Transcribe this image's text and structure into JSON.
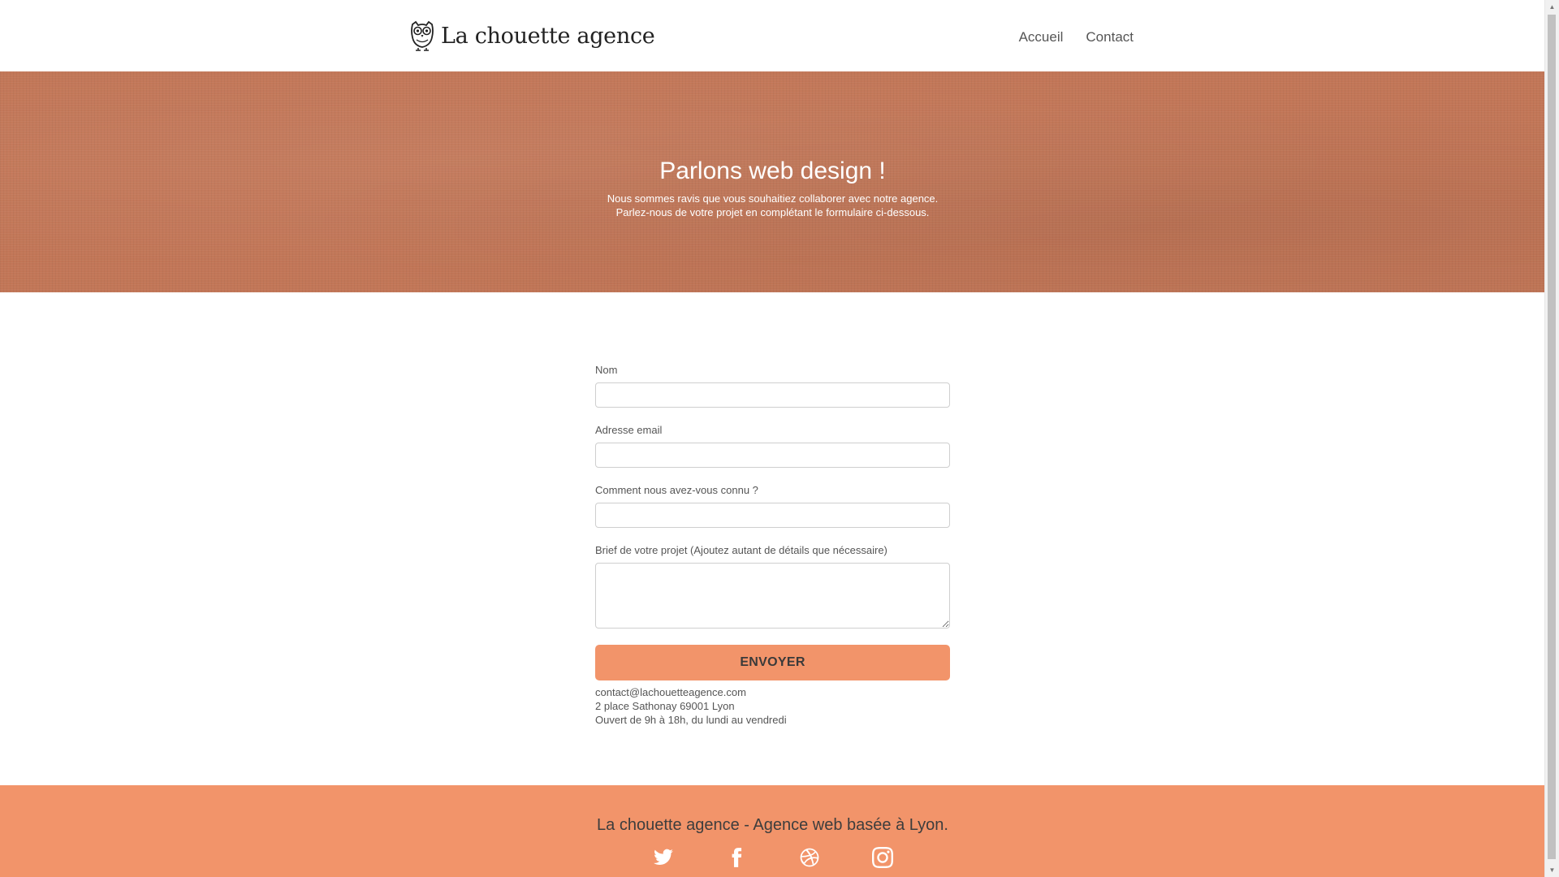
{
  "brand": {
    "name": "La chouette agence"
  },
  "nav": {
    "items": [
      {
        "label": "Accueil"
      },
      {
        "label": "Contact"
      }
    ]
  },
  "hero": {
    "title": "Parlons web design !",
    "line1": "Nous sommes ravis que vous souhaitiez collaborer avec notre agence.",
    "line2": "Parlez-nous de votre projet en complétant le formulaire ci-dessous."
  },
  "form": {
    "name_label": "Nom",
    "name_value": "",
    "email_label": "Adresse email",
    "email_value": "",
    "source_label": "Comment nous avez-vous connu ?",
    "source_value": "",
    "brief_label": "Brief de votre projet (Ajoutez autant de détails que nécessaire)",
    "brief_value": "",
    "submit_label": "ENVOYER"
  },
  "contact": {
    "email": "contact@lachouetteagence.com",
    "address": "2 place Sathonay 69001 Lyon",
    "hours": "Ouvert de 9h à 18h, du lundi au vendredi"
  },
  "footer": {
    "text": "La chouette agence - Agence web basée à Lyon.",
    "socials": [
      "twitter-icon",
      "facebook-icon",
      "dribbble-icon",
      "instagram-icon"
    ]
  },
  "colors": {
    "accent": "#f2946a",
    "hero": "#c27657"
  }
}
